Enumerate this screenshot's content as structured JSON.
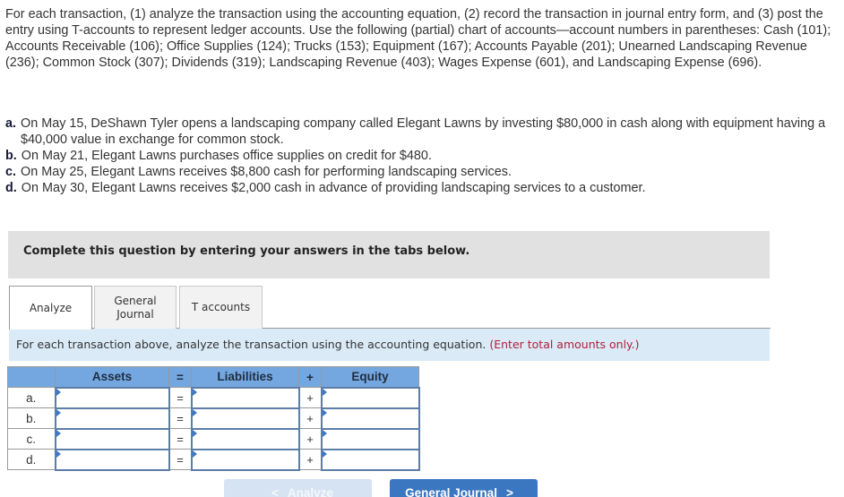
{
  "intro_text": "For each transaction, (1) analyze the transaction using the accounting equation, (2) record the transaction in journal entry form, and (3) post the entry using T-accounts to represent ledger accounts. Use the following (partial) chart of accounts—account numbers in parentheses: Cash (101); Accounts Receivable (106); Office Supplies (124); Trucks (153); Equipment (167); Accounts Payable (201); Unearned Landscaping Revenue (236); Common Stock (307); Dividends (319); Landscaping Revenue (403); Wages Expense (601), and Landscaping Expense (696).",
  "transactions": [
    {
      "label": "a.",
      "text": "On May 15, DeShawn Tyler opens a landscaping company called Elegant Lawns by investing $80,000 in cash along with equipment having a $40,000 value in exchange for common stock."
    },
    {
      "label": "b.",
      "text": "On May 21, Elegant Lawns purchases office supplies on credit for $480."
    },
    {
      "label": "c.",
      "text": "On May 25, Elegant Lawns receives $8,800 cash for performing landscaping services."
    },
    {
      "label": "d.",
      "text": "On May 30, Elegant Lawns receives $2,000 cash in advance of providing landscaping services to a customer."
    }
  ],
  "instruction_box": "Complete this question by entering your answers in the tabs below.",
  "tabs": [
    {
      "label": "Analyze",
      "active": true
    },
    {
      "label_line1": "General",
      "label_line2": "Journal",
      "active": false
    },
    {
      "label": "T accounts",
      "active": false
    }
  ],
  "analysis_banner": {
    "text": "For each transaction above, analyze the transaction using the accounting equation.",
    "note": "(Enter total amounts only.)"
  },
  "equation_table": {
    "headers": {
      "label": "",
      "assets": "Assets",
      "eq": "=",
      "liabilities": "Liabilities",
      "plus": "+",
      "equity": "Equity"
    },
    "rows": [
      {
        "label": "a.",
        "eq": "=",
        "plus": "+",
        "assets": "",
        "liabilities": "",
        "equity": ""
      },
      {
        "label": "b.",
        "eq": "=",
        "plus": "+",
        "assets": "",
        "liabilities": "",
        "equity": ""
      },
      {
        "label": "c.",
        "eq": "=",
        "plus": "+",
        "assets": "",
        "liabilities": "",
        "equity": ""
      },
      {
        "label": "d.",
        "eq": "=",
        "plus": "+",
        "assets": "",
        "liabilities": "",
        "equity": ""
      }
    ]
  },
  "nav": {
    "prev_label": "Analyze",
    "prev_icon": "chevron-left-icon",
    "prev_chevron": "<",
    "next_label": "General Journal",
    "next_icon": "chevron-right-icon",
    "next_chevron": ">"
  },
  "colors": {
    "header_blue": "#74a7e0",
    "banner_blue": "#daeaf7",
    "note_red": "#b0203c",
    "next_button": "#3b76c0",
    "prev_button_disabled": "#d6e3f3"
  }
}
